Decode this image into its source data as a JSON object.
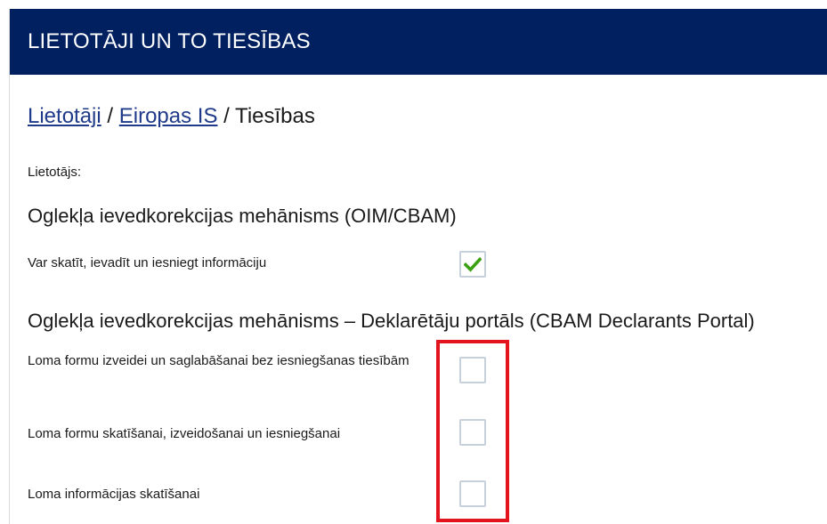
{
  "header": {
    "title": "LIETOTĀJI UN TO TIESĪBAS"
  },
  "breadcrumb": {
    "link1": "Lietotāji",
    "sep1": " / ",
    "link2": "Eiropas IS",
    "sep2": " / ",
    "current": "Tiesības"
  },
  "user_label": "Lietotājs:",
  "sections": [
    {
      "title": "Oglekļa ievedkorekcijas mehānisms (OIM/CBAM)",
      "rows": [
        {
          "label": "Var skatīt, ievadīt un iesniegt informāciju",
          "checked": true
        }
      ]
    },
    {
      "title": "Oglekļa ievedkorekcijas mehānisms – Deklarētāju portāls (CBAM Declarants Portal)",
      "rows": [
        {
          "label": "Loma formu izveidei un saglabāšanai bez iesniegšanas tiesībām",
          "checked": false
        },
        {
          "label": "Loma formu skatīšanai, izveidošanai un iesniegšanai",
          "checked": false
        },
        {
          "label": "Loma informācijas skatīšanai",
          "checked": false
        }
      ]
    }
  ],
  "colors": {
    "header_bg": "#002060",
    "link": "#1f3a8a",
    "check_green": "#3aa112",
    "highlight_red": "#e3141e"
  }
}
